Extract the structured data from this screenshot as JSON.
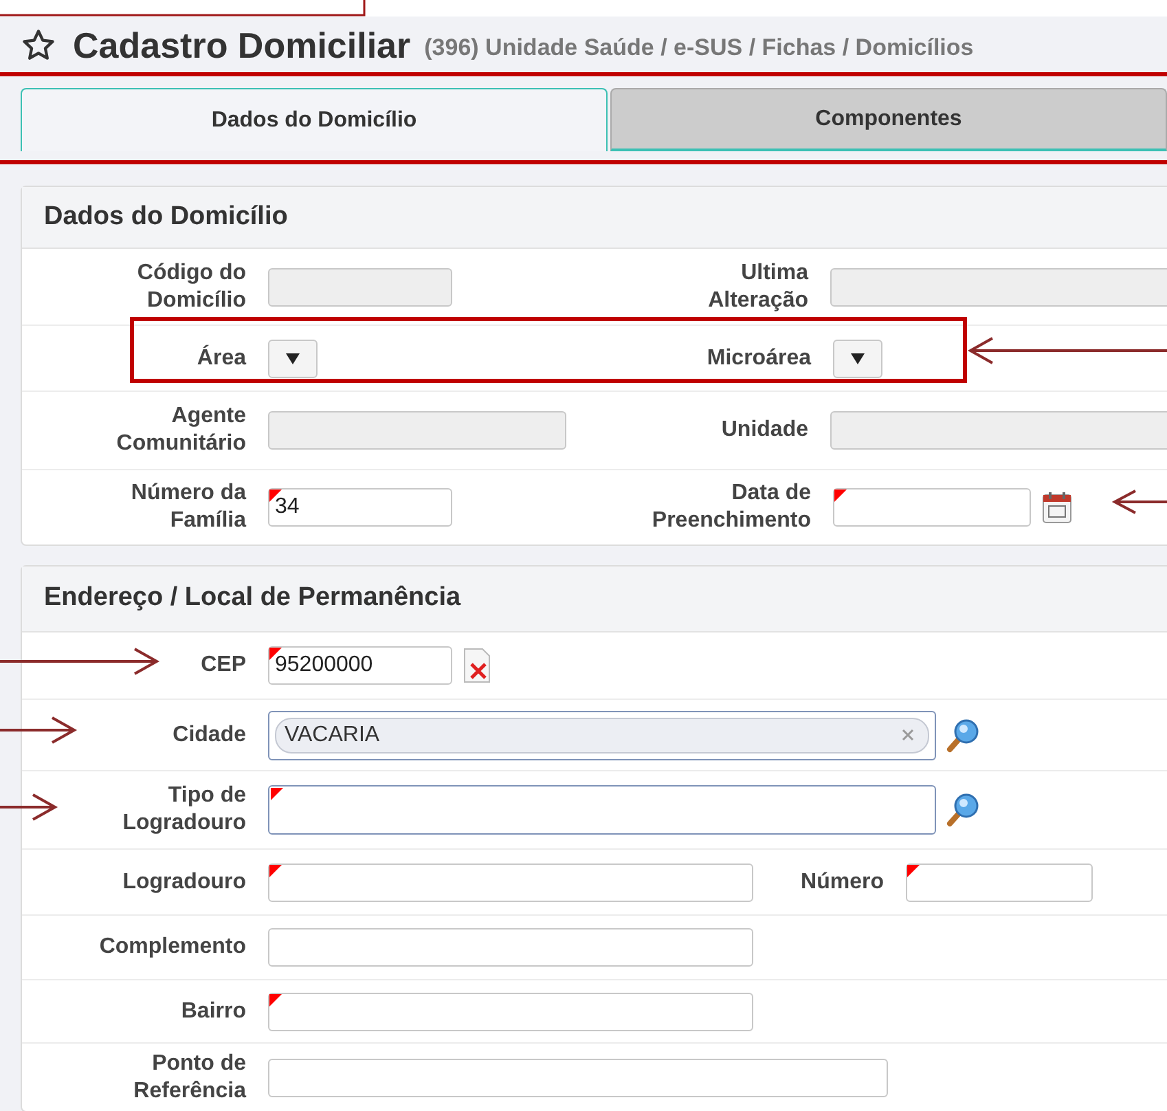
{
  "header": {
    "title": "Cadastro Domiciliar",
    "breadcrumb": "(396) Unidade Saúde / e-SUS / Fichas / Domicílios"
  },
  "tabs": [
    {
      "label": "Dados do Domicílio",
      "selected": true
    },
    {
      "label": "Componentes",
      "selected": false
    }
  ],
  "sections": [
    {
      "title": "Dados do Domicílio",
      "rows": [
        {
          "fields": [
            {
              "label": [
                "Código do",
                "Domicílio"
              ],
              "kind": "text",
              "disabled": true,
              "required": false
            },
            {
              "label": [
                "Ultima",
                "Alteração"
              ],
              "kind": "text",
              "disabled": true,
              "required": false
            }
          ]
        },
        {
          "fields": [
            {
              "label": [
                "Área"
              ],
              "kind": "select",
              "disabled": false,
              "required": false
            },
            {
              "label": [
                "Microárea"
              ],
              "kind": "select",
              "disabled": false,
              "required": false
            }
          ]
        },
        {
          "fields": [
            {
              "label": [
                "Agente",
                "Comunitário"
              ],
              "kind": "text",
              "disabled": true,
              "required": false
            },
            {
              "label": [
                "Unidade"
              ],
              "kind": "text",
              "disabled": true,
              "required": false
            }
          ]
        },
        {
          "fields": [
            {
              "label": [
                "Número da",
                "Família"
              ],
              "kind": "text",
              "disabled": false,
              "required": true,
              "value": "34"
            },
            {
              "label": [
                "Data de",
                "Preenchimento"
              ],
              "kind": "date",
              "disabled": false,
              "required": true
            }
          ]
        }
      ]
    },
    {
      "title": "Endereço / Local de Permanência",
      "rows": [
        {
          "fields": [
            {
              "label": [
                "CEP"
              ],
              "kind": "cep",
              "disabled": false,
              "required": true,
              "value": "95200000"
            }
          ]
        },
        {
          "fields": [
            {
              "label": [
                "Cidade"
              ],
              "kind": "lookup",
              "disabled": false,
              "required": false,
              "value": "VACARIA"
            }
          ]
        },
        {
          "fields": [
            {
              "label": [
                "Tipo de",
                "Logradouro"
              ],
              "kind": "lookup",
              "disabled": false,
              "required": true
            }
          ]
        },
        {
          "fields": [
            {
              "label": [
                "Logradouro"
              ],
              "kind": "text",
              "disabled": false,
              "required": true
            },
            {
              "label": [
                "Número"
              ],
              "kind": "text",
              "disabled": false,
              "required": true
            }
          ]
        },
        {
          "fields": [
            {
              "label": [
                "Complemento"
              ],
              "kind": "text",
              "disabled": false,
              "required": false
            }
          ]
        },
        {
          "fields": [
            {
              "label": [
                "Bairro"
              ],
              "kind": "text",
              "disabled": false,
              "required": true
            }
          ]
        },
        {
          "fields": [
            {
              "label": [
                "Ponto de",
                "Referência"
              ],
              "kind": "text",
              "disabled": false,
              "required": false
            }
          ]
        }
      ]
    }
  ]
}
